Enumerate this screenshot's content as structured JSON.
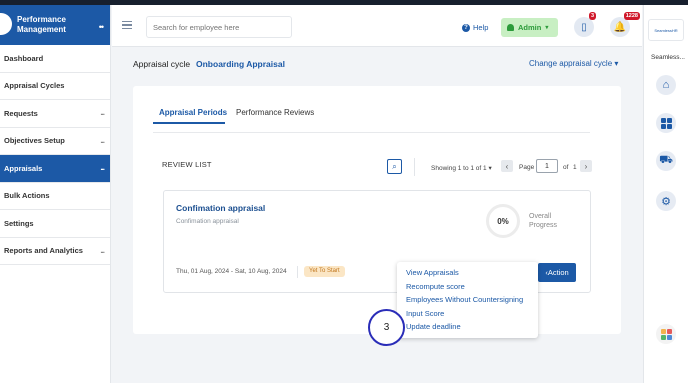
{
  "sidebar": {
    "brand": "Performance Management",
    "items": [
      {
        "label": "Dashboard",
        "more": ""
      },
      {
        "label": "Appraisal Cycles",
        "more": ""
      },
      {
        "label": "Requests",
        "more": "..."
      },
      {
        "label": "Objectives Setup",
        "more": "..."
      },
      {
        "label": "Appraisals",
        "more": "...",
        "active": true
      },
      {
        "label": "Bulk Actions",
        "more": ""
      },
      {
        "label": "Settings",
        "more": ""
      },
      {
        "label": "Reports and Analytics",
        "more": "..."
      }
    ]
  },
  "topbar": {
    "search_placeholder": "Search for employee here",
    "help": "Help",
    "admin": "Admin",
    "notif_a_badge": "3",
    "notif_b_badge": "1228"
  },
  "rail": {
    "logo_text": "SeamlessHR",
    "app_name": "Seamless...",
    "icons": [
      "home-icon",
      "grid-icon",
      "cart-icon",
      "gear-icon",
      "apps-icon"
    ]
  },
  "header": {
    "cycle_label": "Appraisal cycle",
    "cycle_name": "Onboarding Appraisal",
    "change_cycle": "Change appraisal cycle"
  },
  "tabs": [
    {
      "label": "Appraisal Periods",
      "active": true
    },
    {
      "label": "Performance Reviews",
      "active": false
    }
  ],
  "review_list": {
    "title": "REVIEW LIST",
    "showing": "Showing 1 to 1 of 1",
    "page_label": "Page",
    "page_value": "1",
    "of_label": "of",
    "total_pages": "1"
  },
  "appraisal": {
    "title": "Confimation appraisal",
    "subtitle": "Confimation appraisal",
    "progress": "0%",
    "progress_label": "Overall Progress",
    "dates": "Thu, 01 Aug, 2024 - Sat, 10 Aug, 2024",
    "status": "Yet To Start",
    "action": "Action"
  },
  "dropdown": {
    "items": [
      "View Appraisals",
      "Recompute score",
      "Employees Without Countersigning",
      "Input Score",
      "Update deadline"
    ]
  },
  "step_marker": "3",
  "colors": {
    "brand": "#1c59a6",
    "status_bg": "#fbe6c5",
    "status_text": "#c0751b",
    "badge": "#d0182a",
    "admin_bg": "#c8efc3"
  }
}
